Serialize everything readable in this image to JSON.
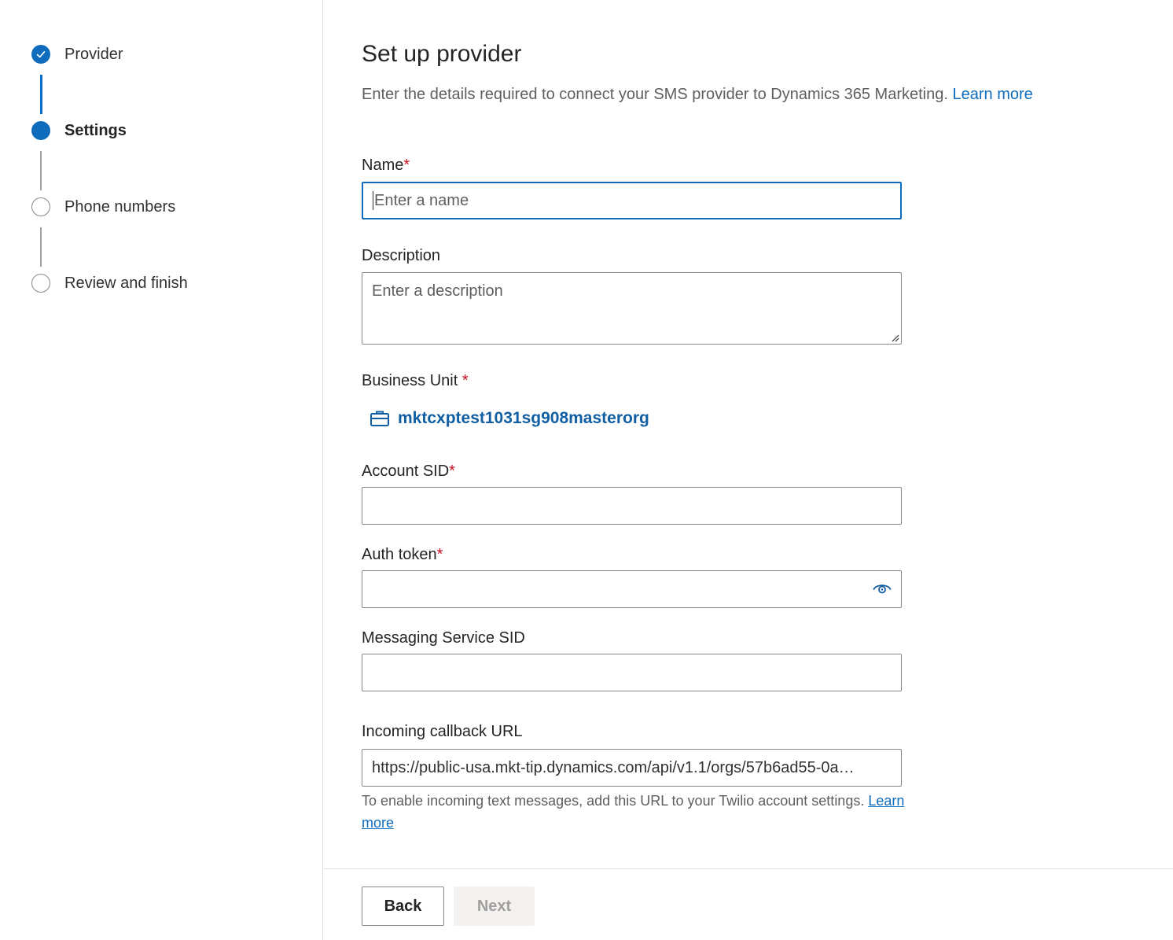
{
  "steps": [
    {
      "label": "Provider",
      "state": "done"
    },
    {
      "label": "Settings",
      "state": "current"
    },
    {
      "label": "Phone numbers",
      "state": "todo"
    },
    {
      "label": "Review and finish",
      "state": "todo"
    }
  ],
  "header": {
    "title": "Set up provider",
    "subtitle": "Enter the details required to connect your SMS provider to Dynamics 365 Marketing.",
    "learn_more": "Learn more"
  },
  "form": {
    "name": {
      "label": "Name",
      "required_mark": "*",
      "placeholder": "Enter a name",
      "value": ""
    },
    "description": {
      "label": "Description",
      "placeholder": "Enter a description",
      "value": ""
    },
    "business_unit": {
      "label": "Business Unit",
      "required_mark": "*",
      "value": "mktcxptest1031sg908masterorg",
      "icon": "briefcase-icon"
    },
    "account_sid": {
      "label": "Account SID",
      "required_mark": "*",
      "value": ""
    },
    "auth_token": {
      "label": "Auth token",
      "required_mark": "*",
      "value": "",
      "icon": "eye-icon"
    },
    "messaging_service_sid": {
      "label": "Messaging Service SID",
      "value": ""
    },
    "callback_url": {
      "label": "Incoming callback URL",
      "value": "https://public-usa.mkt-tip.dynamics.com/api/v1.1/orgs/57b6ad55-0a…",
      "hint": "To enable incoming text messages, add this URL to your Twilio account settings.",
      "hint_link": "Learn more"
    }
  },
  "footer": {
    "back_label": "Back",
    "next_label": "Next"
  },
  "colors": {
    "accent": "#0f6cbd",
    "required": "#c50f1f",
    "link_dark": "#115ea3"
  }
}
